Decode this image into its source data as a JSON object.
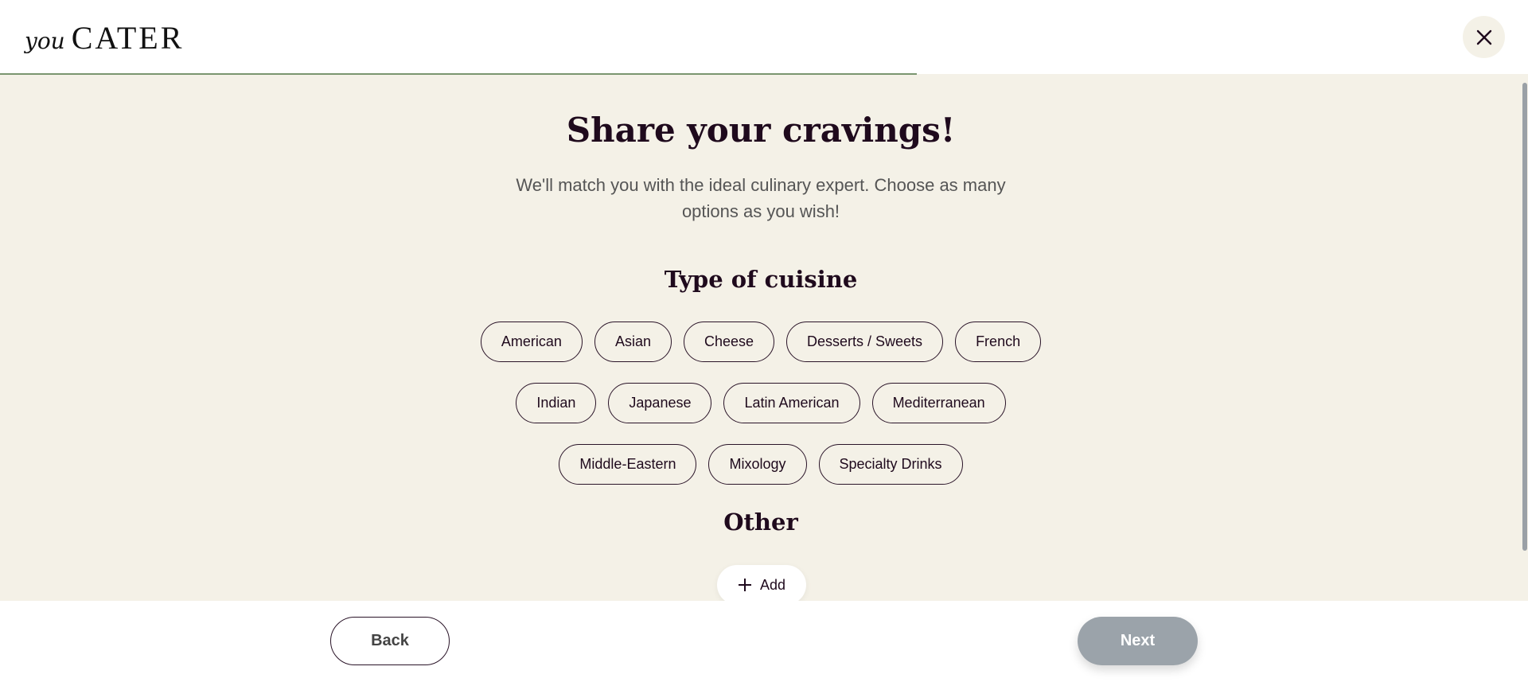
{
  "header": {
    "logo_prefix": "you",
    "logo_main": "CATER",
    "close_icon": "close-icon",
    "progress_percent": 60,
    "progress_color": "#7a9670"
  },
  "main": {
    "title": "Share your cravings!",
    "subtitle": "We'll match you with the ideal culinary expert. Choose as many options as you wish!",
    "cuisine_heading": "Type of cuisine",
    "cuisine_rows": [
      [
        "American",
        "Asian",
        "Cheese",
        "Desserts / Sweets",
        "French"
      ],
      [
        "Indian",
        "Japanese",
        "Latin American",
        "Mediterranean"
      ],
      [
        "Middle-Eastern",
        "Mixology",
        "Specialty Drinks"
      ]
    ],
    "other_heading": "Other",
    "add_label": "Add",
    "add_icon": "plus-icon"
  },
  "footer": {
    "back_label": "Back",
    "next_label": "Next",
    "next_color": "#9ba3aa"
  },
  "colors": {
    "background": "#f4f1e7",
    "text": "#1f0a1d"
  }
}
